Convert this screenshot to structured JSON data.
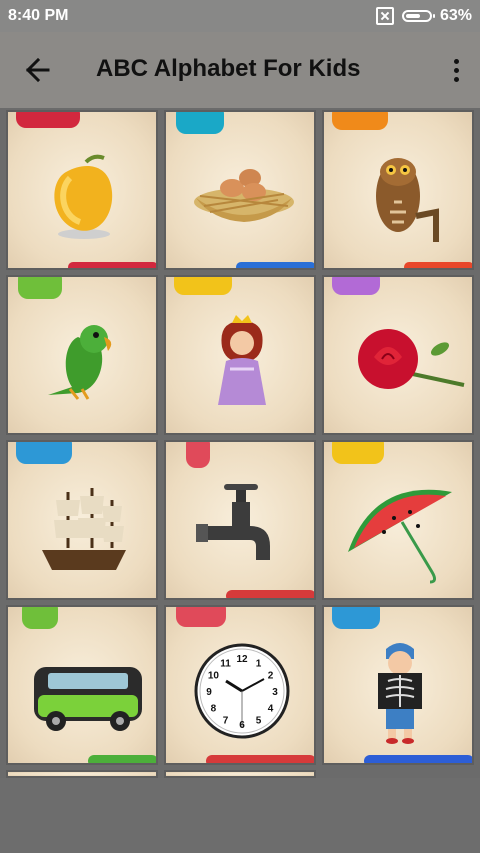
{
  "status_bar": {
    "time": "8:40 PM",
    "battery": "63%",
    "battery_level": 0.63
  },
  "toolbar": {
    "title": "ABC Alphabet For Kids",
    "back_icon": "arrow-left-icon",
    "menu_icon": "more-vert-icon"
  },
  "tiles": [
    {
      "subject": "mango"
    },
    {
      "subject": "nest"
    },
    {
      "subject": "owl"
    },
    {
      "subject": "parrot"
    },
    {
      "subject": "queen"
    },
    {
      "subject": "rose"
    },
    {
      "subject": "ship"
    },
    {
      "subject": "tap"
    },
    {
      "subject": "umbrella"
    },
    {
      "subject": "van"
    },
    {
      "subject": "watch"
    },
    {
      "subject": "x-ray"
    }
  ],
  "clock_numbers": [
    "12",
    "1",
    "2",
    "3",
    "4",
    "5",
    "6",
    "7",
    "8",
    "9",
    "10",
    "11"
  ]
}
